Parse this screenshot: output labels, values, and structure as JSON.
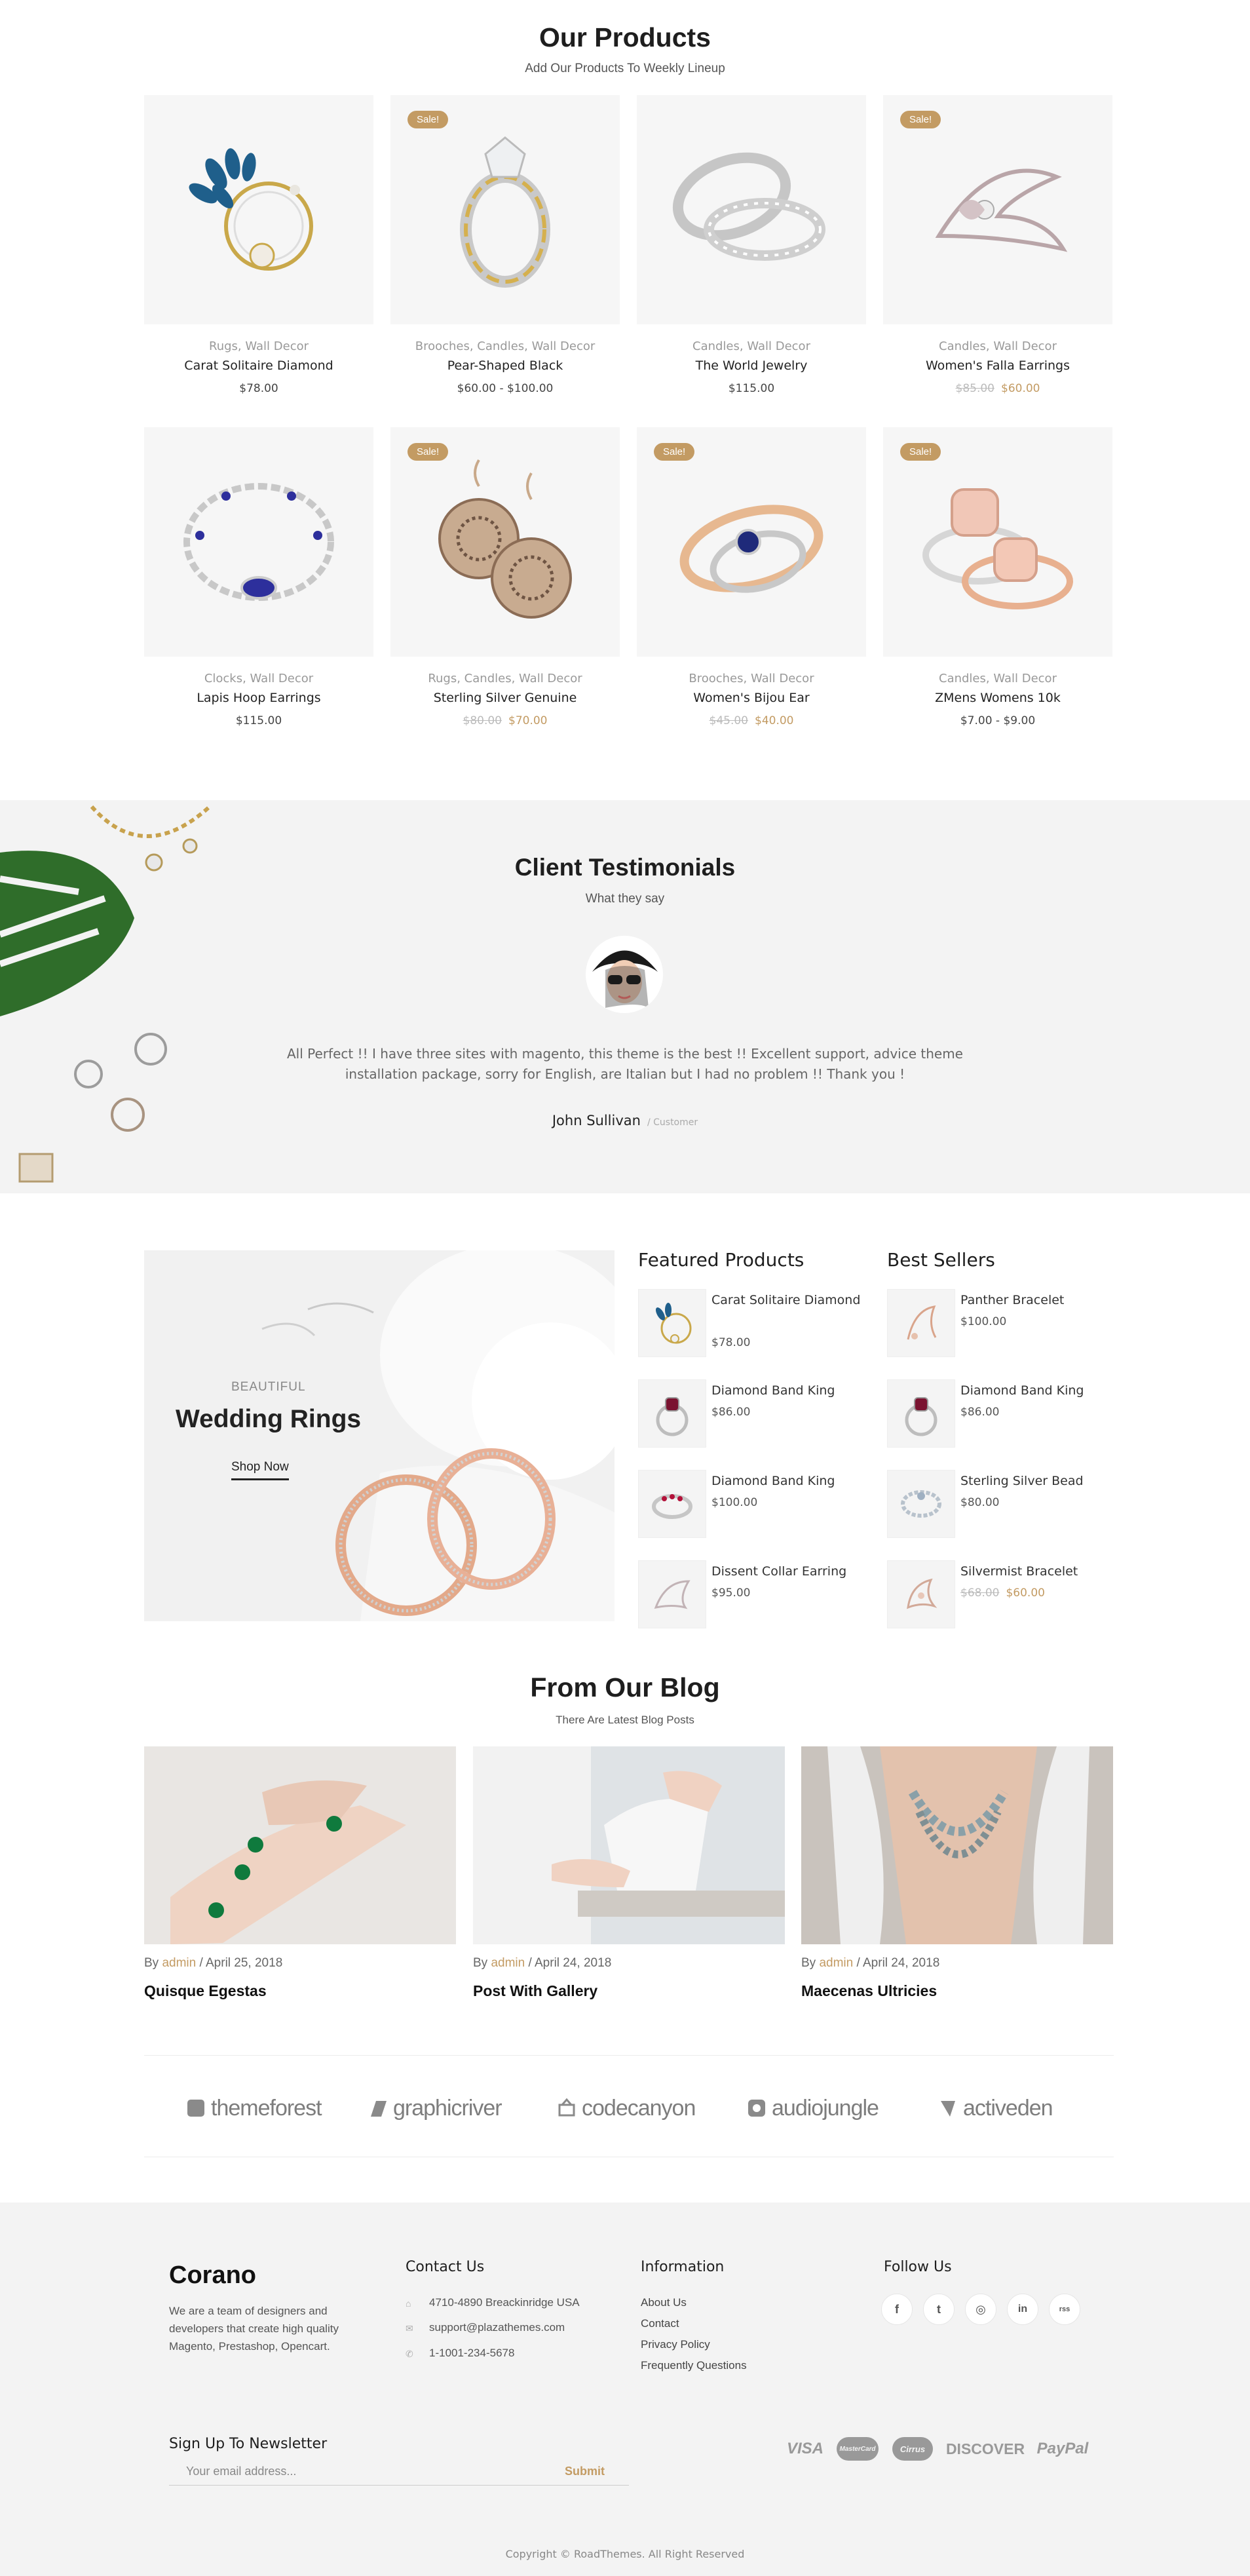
{
  "products": {
    "title": "Our Products",
    "subtitle": "Add Our Products To Weekly Lineup",
    "sale_label": "Sale!",
    "items": [
      {
        "cats": "Rugs, Wall Decor",
        "name": "Carat Solitaire Diamond",
        "price": "$78.00",
        "icon": "peacock-brooch-icon"
      },
      {
        "cats": "Brooches, Candles, Wall Decor",
        "name": "Pear-Shaped Black",
        "price": "$60.00 - $100.00",
        "icon": "diamond-ring-icon"
      },
      {
        "cats": "Candles, Wall Decor",
        "name": "The World Jewelry",
        "price": "$115.00",
        "icon": "band-rings-icon"
      },
      {
        "cats": "Candles, Wall Decor",
        "name": "Women's Falla Earrings",
        "old_price": "$85.00",
        "new_price": "$60.00",
        "icon": "flower-brooch-icon"
      },
      {
        "cats": "Clocks, Wall Decor",
        "name": "Lapis Hoop Earrings",
        "price": "$115.00",
        "icon": "bracelet-icon"
      },
      {
        "cats": "Rugs, Candles, Wall Decor",
        "name": "Sterling Silver Genuine",
        "old_price": "$80.00",
        "new_price": "$70.00",
        "icon": "disc-earrings-icon"
      },
      {
        "cats": "Brooches, Wall Decor",
        "name": "Women's Bijou Ear",
        "old_price": "$45.00",
        "new_price": "$40.00",
        "icon": "sapphire-ring-icon"
      },
      {
        "cats": "Candles, Wall Decor",
        "name": "ZMens Womens 10k",
        "price": "$7.00 - $9.00",
        "icon": "morganite-rings-icon"
      }
    ]
  },
  "testimonials": {
    "title": "Client Testimonials",
    "subtitle": "What they say",
    "quote": "All Perfect !! I have three sites with magento, this theme is the best !! Excellent support, advice theme installation package, sorry for English, are Italian but I had no problem !! Thank you !",
    "author": "John Sullivan",
    "role": "/ Customer"
  },
  "banner": {
    "eyebrow": "BEAUTIFUL",
    "title": "Wedding Rings",
    "link": "Shop Now"
  },
  "featured": {
    "title": "Featured Products",
    "items": [
      {
        "name": "Carat Solitaire Diamond",
        "price": "$78.00"
      },
      {
        "name": "Diamond Band King",
        "price": "$86.00"
      },
      {
        "name": "Diamond Band King",
        "price": "$100.00"
      },
      {
        "name": "Dissent Collar Earring",
        "price": "$95.00"
      }
    ]
  },
  "bestsellers": {
    "title": "Best Sellers",
    "items": [
      {
        "name": "Panther Bracelet",
        "price": "$100.00"
      },
      {
        "name": "Diamond Band King",
        "price": "$86.00"
      },
      {
        "name": "Sterling Silver Bead",
        "price": "$80.00"
      },
      {
        "name": "Silvermist Bracelet",
        "old_price": "$68.00",
        "new_price": "$60.00"
      }
    ]
  },
  "blog": {
    "title": "From Our Blog",
    "subtitle": "There Are Latest Blog Posts",
    "by": "By",
    "posts": [
      {
        "author": "admin",
        "date": "/ April 25, 2018",
        "title": "Quisque Egestas"
      },
      {
        "author": "admin",
        "date": "/ April 24, 2018",
        "title": "Post With Gallery"
      },
      {
        "author": "admin",
        "date": "/ April 24, 2018",
        "title": "Maecenas Ultricies"
      }
    ]
  },
  "brands": [
    "themeforest",
    "graphicriver",
    "codecanyon",
    "audiojungle",
    "activeden"
  ],
  "footer": {
    "logo": "Corano",
    "about": "We are a team of designers and developers that create high quality Magento, Prestashop, Opencart.",
    "contact_title": "Contact Us",
    "address": "4710-4890 Breackinridge USA",
    "email": "support@plazathemes.com",
    "phone": "1-1001-234-5678",
    "info_title": "Information",
    "info_links": [
      "About Us",
      "Contact",
      "Privacy Policy",
      "Frequently Questions"
    ],
    "follow_title": "Follow Us",
    "social": [
      "f",
      "t",
      "◎",
      "in",
      "rss"
    ],
    "newsletter_title": "Sign Up To Newsletter",
    "newsletter_placeholder": "Your email address...",
    "newsletter_submit": "Submit",
    "payments": [
      "VISA",
      "MasterCard",
      "Cirrus",
      "DISCOVER",
      "PayPal"
    ],
    "copyright": "Copyright © RoadThemes. All Right Reserved"
  },
  "colors": {
    "accent": "#c39b63",
    "section_bg": "#f3f3f3",
    "text": "#222222"
  }
}
